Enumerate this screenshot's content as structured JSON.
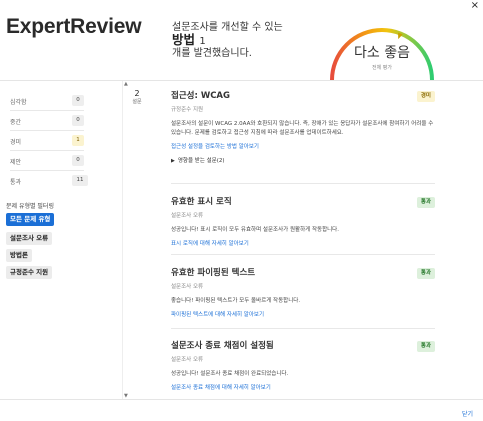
{
  "window": {
    "close_glyph": "×"
  },
  "header": {
    "logo": "ExpertReview",
    "headline_line1": "설문조사를 개선할 수 있는",
    "headline_bold": "방법",
    "headline_count": "1",
    "headline_line3": "개를 발견했습니다.",
    "gauge_label": "다소 좋음",
    "gauge_sub": "전체 평가",
    "gauge_level": 0.62,
    "gauge_colors": [
      "#e74c3c",
      "#f39c12",
      "#f1c40f",
      "#2ecc71"
    ]
  },
  "sidebar": {
    "severity": [
      {
        "label": "심각함",
        "count": "0"
      },
      {
        "label": "중간",
        "count": "0"
      },
      {
        "label": "경미",
        "count": "1"
      },
      {
        "label": "제안",
        "count": "0"
      },
      {
        "label": "통과",
        "count": "11"
      }
    ],
    "filter_title": "문제 유형별 필터링",
    "filters": [
      {
        "label": "모든 문제 유형",
        "active": true
      },
      {
        "label": "설문조사 오류",
        "active": false
      },
      {
        "label": "방법론",
        "active": false
      },
      {
        "label": "규정준수 지원",
        "active": false
      }
    ]
  },
  "main": {
    "issue_count": "2",
    "issue_count_unit": "설문",
    "issues": [
      {
        "title": "접근성: WCAG",
        "category": "규정준수 지원",
        "badge": "경미",
        "badge_type": "warn",
        "description": "설문조사의 설문이 WCAG 2.0AA와 호환되지 않습니다. 즉, 장애가 있는 응답자가 설문조사에 참여하기 어려울 수 있습니다. 문제를 검토하고 접근성 지침에 따라 설문조사를 업데이트하세요.",
        "link": "접근성 설정을 검토하는 방법 알아보기",
        "expand": "영향을 받는 설문(2)"
      },
      {
        "title": "유효한 표시 로직",
        "category": "설문조사 오류",
        "badge": "통과",
        "badge_type": "pass",
        "description": "성공입니다! 표시 로직이 모두 유효하며 설문조사가 원활하게 작동합니다.",
        "link": "표시 로직에 대해 자세히 알아보기"
      },
      {
        "title": "유효한 파이핑된 텍스트",
        "category": "설문조사 오류",
        "badge": "통과",
        "badge_type": "pass",
        "description": "좋습니다! 파이핑된 텍스트가 모두 올바르게 작동합니다.",
        "link": "파이핑된 텍스트에 대해 자세히 알아보기"
      },
      {
        "title": "설문조사 종료 채점이 설정됨",
        "category": "설문조사 오류",
        "badge": "통과",
        "badge_type": "pass",
        "description": "성공입니다! 설문조사 종료 채점이 완료되었습니다.",
        "link": "설문조사 종료 채점에 대해 자세히 알아보기"
      }
    ]
  },
  "footer": {
    "close_label": "닫기"
  }
}
